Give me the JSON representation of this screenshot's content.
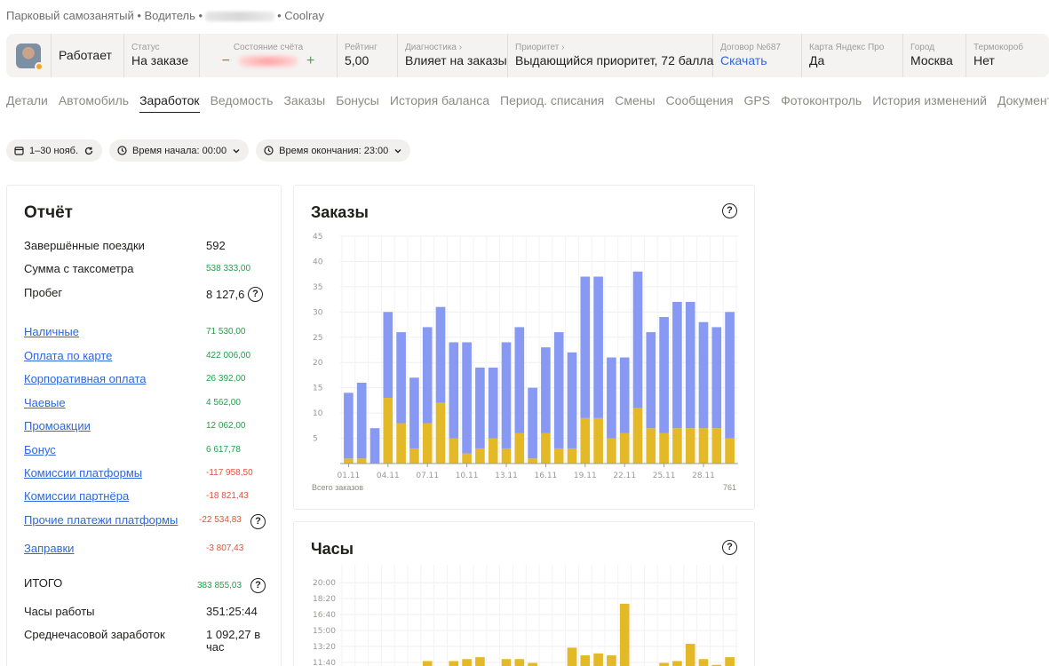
{
  "breadcrumb": {
    "part1": "Парковый самозанятый • Водитель •",
    "part2": "• Coolray"
  },
  "infobar": {
    "work_status": "Работает",
    "status": {
      "label": "Статус",
      "value": "На заказе"
    },
    "balance": {
      "label": "Состояние счёта",
      "minus": "−",
      "plus": "+"
    },
    "rating": {
      "label": "Рейтинг",
      "value": "5,00"
    },
    "diagnostics": {
      "label": "Диагностика",
      "value": "Влияет на заказы"
    },
    "priority": {
      "label": "Приоритет",
      "value": "Выдающийся приоритет, 72 балла"
    },
    "contract": {
      "label": "Договор №687",
      "value": "Скачать"
    },
    "yandex_card": {
      "label": "Карта Яндекс Про",
      "value": "Да"
    },
    "city": {
      "label": "Город",
      "value": "Москва"
    },
    "thermobox": {
      "label": "Термокороб",
      "value": "Нет"
    }
  },
  "tabs": [
    "Детали",
    "Автомобиль",
    "Заработок",
    "Ведомость",
    "Заказы",
    "Бонусы",
    "История баланса",
    "Период. списания",
    "Смены",
    "Сообщения",
    "GPS",
    "Фотоконтроль",
    "История изменений",
    "Документы"
  ],
  "active_tab": "Заработок",
  "filters": {
    "period": "1–30 нояб.",
    "start_time": "Время начала: 00:00",
    "end_time": "Время окончания: 23:00"
  },
  "report": {
    "title": "Отчёт",
    "trips_label": "Завершённые поездки",
    "trips_value": "592",
    "taximeter_label": "Сумма с таксометра",
    "taximeter_value": "538 333,00",
    "mileage_label": "Пробег",
    "mileage_value": "8 127,6",
    "items": [
      {
        "label": "Наличные",
        "value": "71 530,00",
        "sign": "pos"
      },
      {
        "label": "Оплата по карте",
        "value": "422 006,00",
        "sign": "pos"
      },
      {
        "label": "Корпоративная оплата",
        "value": "26 392,00",
        "sign": "pos"
      },
      {
        "label": "Чаевые",
        "value": "4 562,00",
        "sign": "pos"
      },
      {
        "label": "Промоакции",
        "value": "12 062,00",
        "sign": "pos"
      },
      {
        "label": "Бонус",
        "value": "6 617,78",
        "sign": "pos"
      },
      {
        "label": "Комиссии платформы",
        "value": "-117 958,50",
        "sign": "neg"
      },
      {
        "label": "Комиссии партнёра",
        "value": "-18 821,43",
        "sign": "neg"
      },
      {
        "label": "Прочие платежи платформы",
        "value": "-22 534,83",
        "sign": "neg"
      },
      {
        "label": "Заправки",
        "value": "-3 807,43",
        "sign": "neg"
      }
    ],
    "total_label": "ИТОГО",
    "total_value": "383 855,03",
    "hours_label": "Часы работы",
    "hours_value": "351:25:44",
    "avg_label": "Среднечасовой заработок",
    "avg_value": "1 092,27 в",
    "avg_unit": "час"
  },
  "orders_card": {
    "title": "Заказы",
    "total_label": "Всего заказов",
    "total_value": "761"
  },
  "hours_card": {
    "title": "Часы"
  },
  "colors": {
    "blue": "#8799f3",
    "yellow": "#e4b928",
    "green": "#1fa34a",
    "red": "#e0533d",
    "link": "#2f67dd"
  },
  "chart_data": [
    {
      "type": "bar",
      "title": "Заказы",
      "stacked": true,
      "categories": [
        "01.11",
        "02.11",
        "03.11",
        "04.11",
        "05.11",
        "06.11",
        "07.11",
        "08.11",
        "09.11",
        "10.11",
        "11.11",
        "12.11",
        "13.11",
        "14.11",
        "15.11",
        "16.11",
        "17.11",
        "18.11",
        "19.11",
        "20.11",
        "21.11",
        "22.11",
        "23.11",
        "24.11",
        "25.11",
        "26.11",
        "27.11",
        "28.11",
        "29.11",
        "30.11"
      ],
      "tick_labels": [
        "01.11",
        "04.11",
        "07.11",
        "10.11",
        "13.11",
        "16.11",
        "19.11",
        "22.11",
        "25.11",
        "28.11"
      ],
      "series": [
        {
          "name": "",
          "color": "#e4b928",
          "values": [
            1,
            1,
            0,
            13,
            8,
            3,
            8,
            12,
            5,
            2,
            3,
            5,
            3,
            6,
            1,
            6,
            3,
            3,
            9,
            9,
            5,
            6,
            11,
            7,
            6,
            7,
            7,
            7,
            7,
            5
          ]
        },
        {
          "name": "",
          "color": "#8799f3",
          "values": [
            13,
            15,
            7,
            17,
            18,
            14,
            19,
            19,
            19,
            22,
            16,
            14,
            21,
            21,
            14,
            17,
            23,
            19,
            28,
            28,
            16,
            15,
            27,
            19,
            23,
            25,
            25,
            21,
            20,
            25
          ]
        }
      ],
      "ylim": [
        0,
        45
      ],
      "yticks": [
        5,
        10,
        15,
        20,
        25,
        30,
        35,
        40,
        45
      ],
      "grid": true
    },
    {
      "type": "bar",
      "title": "Часы",
      "yticks": [
        "11:40",
        "13:20",
        "15:00",
        "16:40",
        "18:20",
        "20:00"
      ],
      "values_hours": [
        null,
        null,
        null,
        null,
        null,
        null,
        11.8,
        null,
        11.8,
        12.0,
        12.2,
        null,
        12.0,
        12.0,
        11.6,
        null,
        null,
        13.2,
        12.4,
        12.6,
        12.4,
        17.8,
        null,
        null,
        11.6,
        11.8,
        13.6,
        12.0,
        11.4,
        12.2
      ],
      "ylim_hours": [
        11.0,
        20.67
      ],
      "grid": true
    }
  ]
}
